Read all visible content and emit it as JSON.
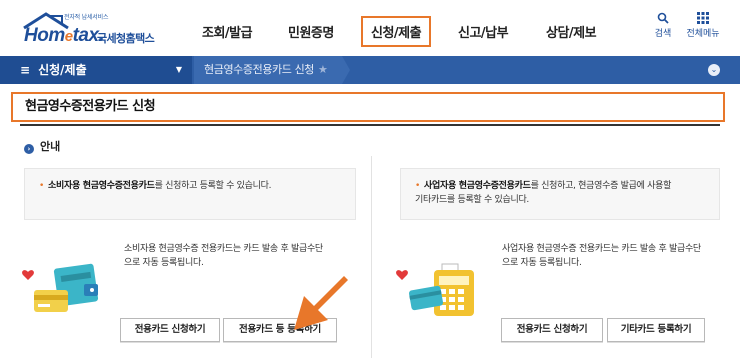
{
  "logo": {
    "tagline": "전자적 납세서비스",
    "brand_home": "Hom",
    "brand_e": "e",
    "brand_tax": "tax.",
    "brand_korean": "국세청홈택스"
  },
  "gnb": {
    "items": [
      "조회/발급",
      "민원증명",
      "신청/제출",
      "신고/납부",
      "상담/제보"
    ],
    "active": "신청/제출",
    "search_label": "검색",
    "allmenu_label": "전체메뉴"
  },
  "bar": {
    "section": "신청/제출",
    "crumb": "현금영수증전용카드 신청"
  },
  "page": {
    "title": "현금영수증전용카드 신청",
    "guide_heading": "안내"
  },
  "left": {
    "notice_bold": "소비자용 현금영수증전용카드",
    "notice_rest": "를 신청하고 등록할 수 있습니다.",
    "desc_line1": "소비자용 현금영수증 전용카드는 카드 발송 후 발급수단",
    "desc_line2": "으로 자동 등록됩니다.",
    "btn_apply": "전용카드 신청하기",
    "btn_register": "전용카드 등 등록하기"
  },
  "right": {
    "notice_bold": "사업자용 현금영수증전용카드",
    "notice_rest1": "를 신청하고, 현금영수증 발급에 사용할",
    "notice_rest2": "기타카드를 등록할 수 있습니다.",
    "desc_line1": "사업자용 현금영수증 전용카드는 카드 발송 후 발급수단",
    "desc_line2": "으로 자동 등록됩니다.",
    "btn_apply": "전용카드 신청하기",
    "btn_register": "기타카드 등록하기"
  },
  "colors": {
    "accent_orange": "#e8772a",
    "nav_blue": "#2e5ea5",
    "brand_blue": "#1f4f9a"
  }
}
